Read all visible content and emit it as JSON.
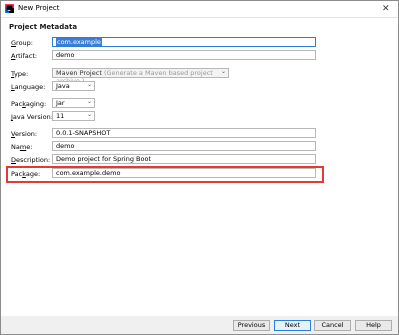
{
  "window": {
    "title": "New Project"
  },
  "section": {
    "title": "Project Metadata"
  },
  "fields": {
    "group": {
      "label_mn": "G",
      "label_rest": "roup:",
      "value": "com.example"
    },
    "artifact": {
      "label_mn": "A",
      "label_rest": "rtifact:",
      "value": "demo"
    },
    "type": {
      "label_mn": "T",
      "label_rest": "ype:",
      "value": "Maven Project",
      "hint": "(Generate a Maven based project archive.)"
    },
    "language": {
      "label_mn": "L",
      "label_rest": "anguage:",
      "value": "Java"
    },
    "packaging": {
      "label_pre": "Pac",
      "label_mn": "k",
      "label_rest": "aging:",
      "value": "Jar"
    },
    "java_version": {
      "label_mn": "J",
      "label_rest": "ava Version:",
      "value": "11"
    },
    "version": {
      "label_mn": "V",
      "label_rest": "ersion:",
      "value": "0.0.1-SNAPSHOT"
    },
    "name": {
      "label_pre": "Na",
      "label_mn": "m",
      "label_rest": "e:",
      "value": "demo"
    },
    "description": {
      "label_mn": "D",
      "label_rest": "escription:",
      "value": "Demo project for Spring Boot"
    },
    "package": {
      "label_pre": "Pac",
      "label_mn": "k",
      "label_rest": "age:",
      "value": "com.example.demo"
    }
  },
  "buttons": {
    "previous": "Previous",
    "next": "Next",
    "cancel": "Cancel",
    "help": "Help"
  },
  "colors": {
    "highlight": "#e53935",
    "focus": "#2a7ed8",
    "selection": "#3b7dd8"
  }
}
